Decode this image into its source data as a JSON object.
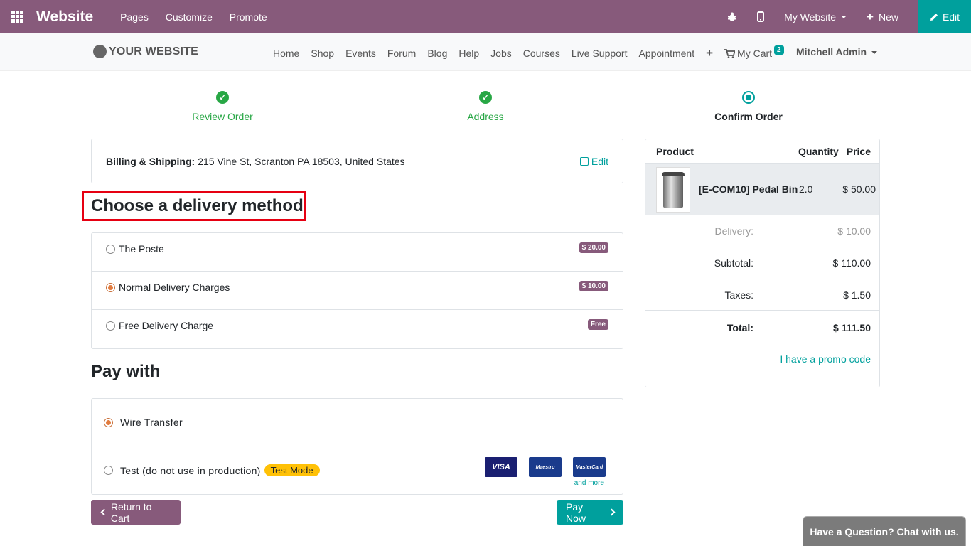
{
  "topbar": {
    "brand": "Website",
    "nav": [
      "Pages",
      "Customize",
      "Promote"
    ],
    "site_selector": "My Website",
    "new_label": "New",
    "edit_label": "Edit",
    "accent": "#875a7b"
  },
  "header": {
    "logo": "YOUR WEBSITE",
    "nav": [
      "Home",
      "Shop",
      "Events",
      "Forum",
      "Blog",
      "Help",
      "Jobs",
      "Courses",
      "Live Support",
      "Appointment"
    ],
    "add_label": "+",
    "cart_label": "My Cart",
    "cart_count": "2",
    "user": "Mitchell Admin"
  },
  "steps": [
    {
      "label": "Review Order",
      "state": "done"
    },
    {
      "label": "Address",
      "state": "done"
    },
    {
      "label": "Confirm Order",
      "state": "current"
    }
  ],
  "billing": {
    "label": "Billing & Shipping:",
    "address": "215 Vine St, Scranton PA 18503, United States",
    "edit_label": "Edit"
  },
  "delivery": {
    "title": "Choose a delivery method",
    "options": [
      {
        "label": "The Poste",
        "price": "$ 20.00",
        "selected": false
      },
      {
        "label": "Normal Delivery Charges",
        "price": "$ 10.00",
        "selected": true
      },
      {
        "label": "Free Delivery Charge",
        "price": "Free",
        "selected": false
      }
    ]
  },
  "payment": {
    "title": "Pay with",
    "options": [
      {
        "label": "Wire Transfer",
        "selected": true
      },
      {
        "label": "Test (do not use in production)",
        "badge": "Test Mode",
        "selected": false
      }
    ],
    "card_logos": [
      "VISA",
      "Maestro",
      "MasterCard"
    ],
    "and_more": "and more"
  },
  "buttons": {
    "return_label": "Return to Cart",
    "pay_label": "Pay Now"
  },
  "summary": {
    "headers": {
      "product": "Product",
      "quantity": "Quantity",
      "price": "Price"
    },
    "item": {
      "name": "[E-COM10] Pedal Bin",
      "quantity": "2.0",
      "price": "$ 50.00"
    },
    "delivery_label": "Delivery:",
    "delivery_value": "$ 10.00",
    "subtotal_label": "Subtotal:",
    "subtotal_value": "$ 110.00",
    "taxes_label": "Taxes:",
    "taxes_value": "$ 1.50",
    "total_label": "Total:",
    "total_value": "$ 111.50",
    "promo_label": "I have a promo code"
  },
  "chat": {
    "label": "Have a Question? Chat with us."
  }
}
